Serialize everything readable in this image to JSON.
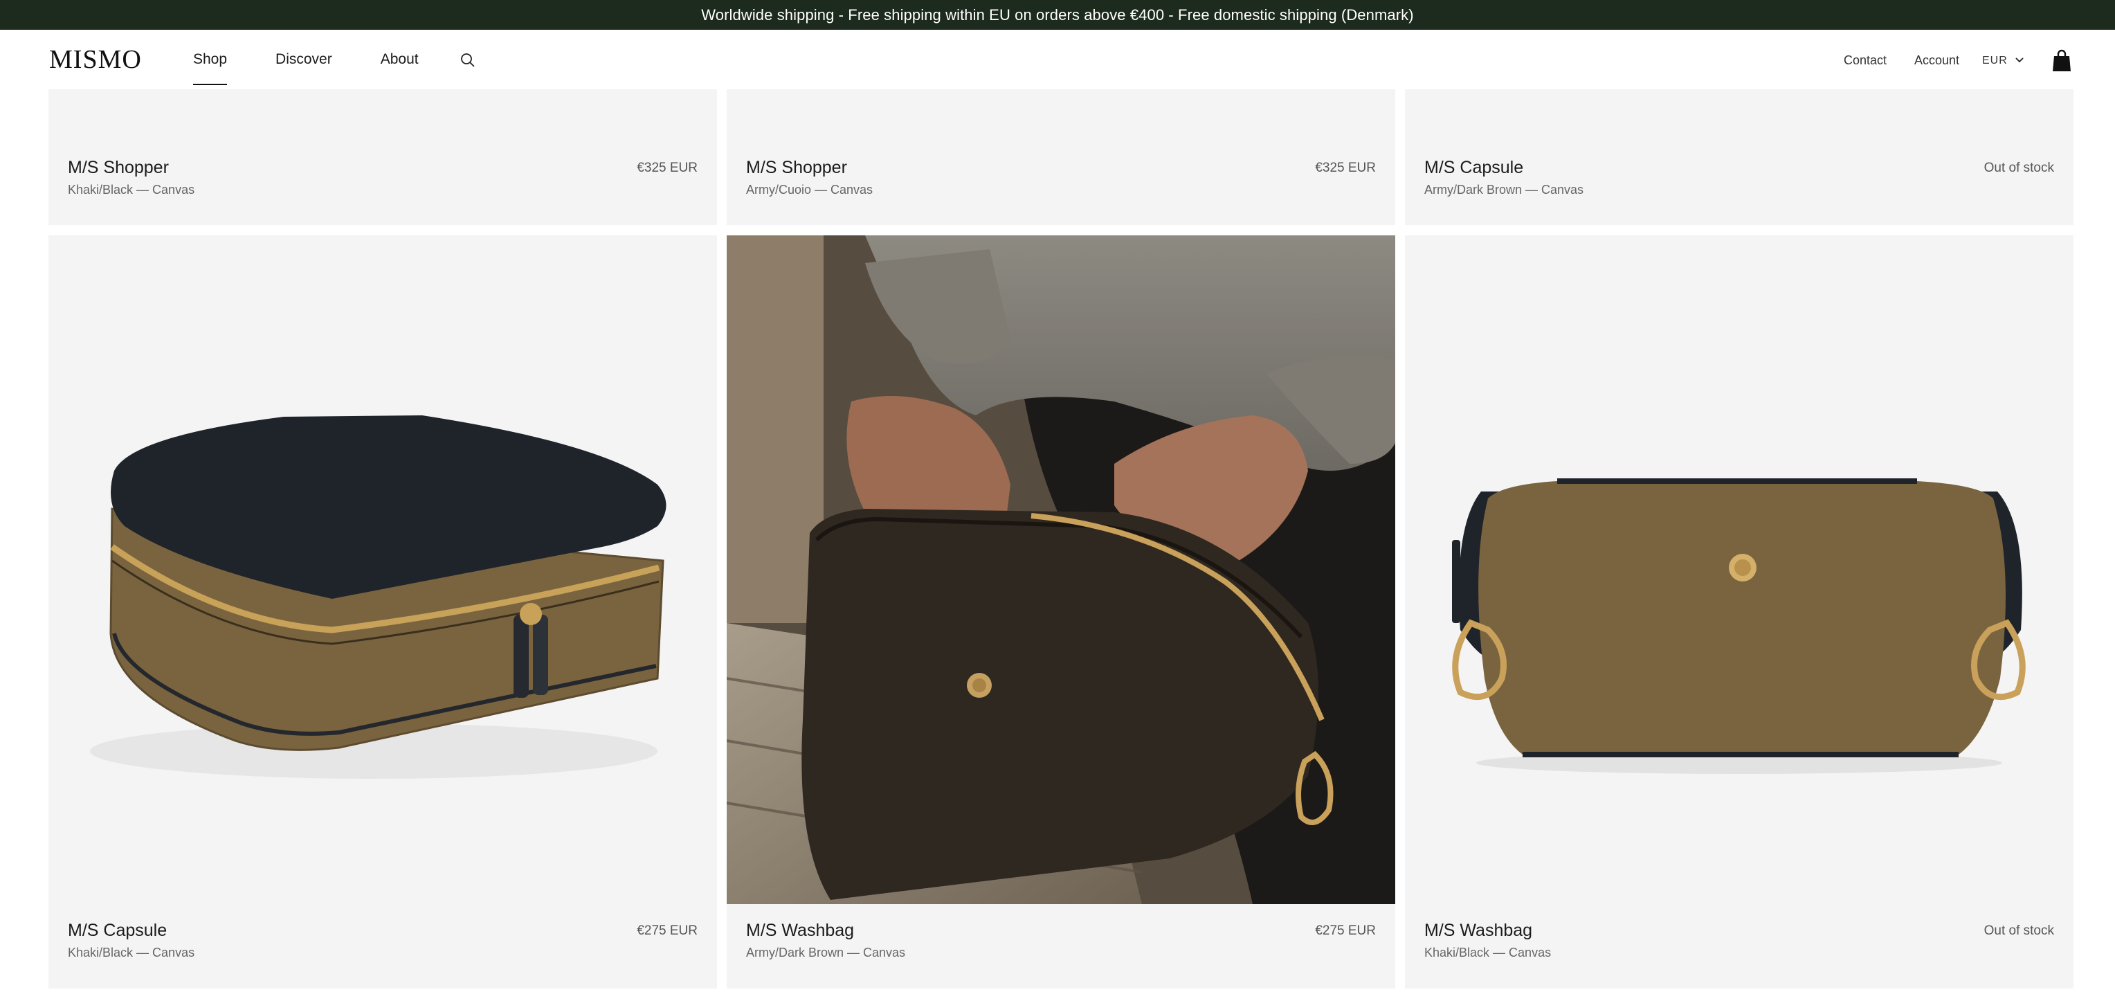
{
  "announcement": "Worldwide shipping - Free shipping within EU on orders above €400 - Free domestic shipping (Denmark)",
  "header": {
    "logo": "MISMO",
    "nav": [
      {
        "label": "Shop",
        "active": true
      },
      {
        "label": "Discover",
        "active": false
      },
      {
        "label": "About",
        "active": false
      }
    ],
    "search_icon": "search-icon",
    "contact": "Contact",
    "account": "Account",
    "currency": "EUR",
    "cart_icon": "shopping-bag-icon"
  },
  "colors": {
    "announcement_bg": "#1d2a1e",
    "card_bg": "#f4f4f4",
    "canvas_khaki": "#7a6440",
    "leather_black": "#1f242b"
  },
  "products": [
    {
      "name": "M/S Shopper",
      "variant": "Khaki/Black — Canvas",
      "price": "€325 EUR"
    },
    {
      "name": "M/S Shopper",
      "variant": "Army/Cuoio — Canvas",
      "price": "€325 EUR"
    },
    {
      "name": "M/S Capsule",
      "variant": "Army/Dark Brown — Canvas",
      "price": "Out of stock"
    },
    {
      "name": "M/S Capsule",
      "variant": "Khaki/Black — Canvas",
      "price": "€275 EUR"
    },
    {
      "name": "M/S Washbag",
      "variant": "Army/Dark Brown — Canvas",
      "price": "€275 EUR"
    },
    {
      "name": "M/S Washbag",
      "variant": "Khaki/Black — Canvas",
      "price": "Out of stock"
    }
  ]
}
